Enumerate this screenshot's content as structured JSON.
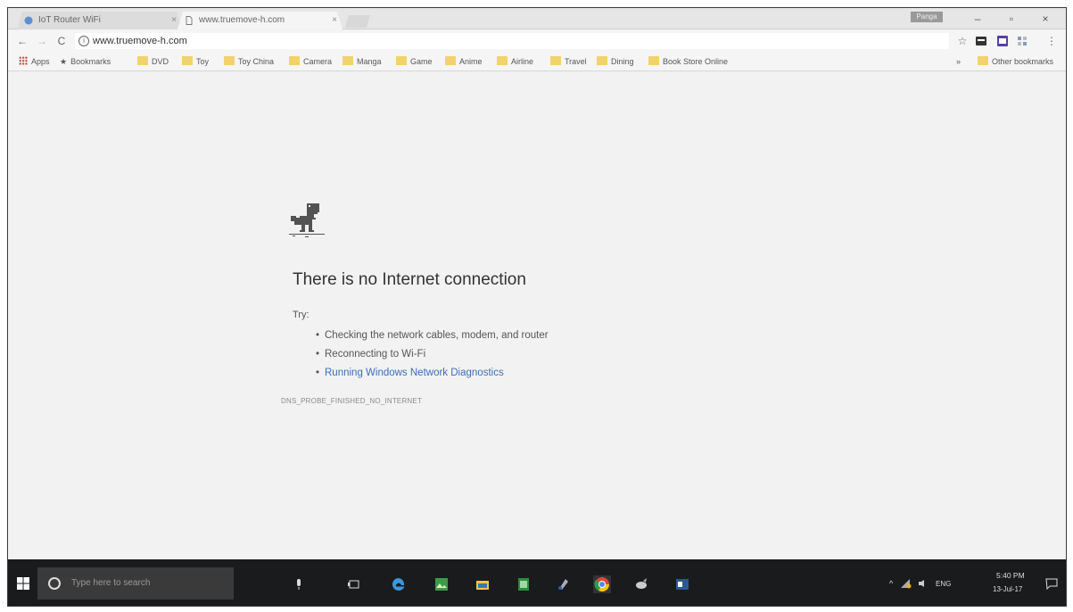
{
  "tabs": [
    {
      "title": "IoT Router WiFi",
      "close": "×"
    },
    {
      "title": "www.truemove-h.com",
      "close": "×"
    }
  ],
  "window": {
    "profile": "Panga",
    "minimize": "–",
    "maximize": "▫",
    "close": "×"
  },
  "toolbar": {
    "back": "←",
    "forward": "→",
    "reload": "C",
    "url": "www.truemove-h.com",
    "star": "☆"
  },
  "bookmarks": {
    "apps": "Apps",
    "bookmarks": "Bookmarks",
    "items": [
      "DVD",
      "Toy",
      "Toy China",
      "Camera",
      "Manga",
      "Game",
      "Anime",
      "Airline",
      "Travel",
      "Dining",
      "Book Store Online"
    ],
    "overflow": "»",
    "other": "Other bookmarks"
  },
  "error": {
    "title": "There is no Internet connection",
    "try": "Try:",
    "suggestions": [
      "Checking the network cables, modem, and router",
      "Reconnecting to Wi-Fi",
      "Running Windows Network Diagnostics"
    ],
    "code": "DNS_PROBE_FINISHED_NO_INTERNET"
  },
  "taskbar": {
    "search_placeholder": "Type here to search",
    "language": "ENG",
    "time": "5:40 PM",
    "date": "13-Jul-17"
  }
}
